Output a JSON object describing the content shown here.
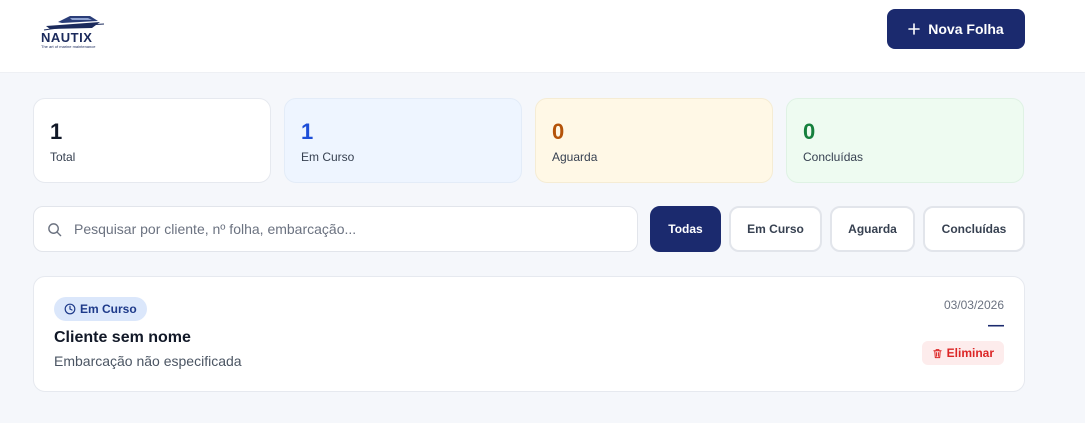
{
  "header": {
    "logo_text": "NAUTIX",
    "logo_tagline": "The art of marine maintenance",
    "new_button_label": "Nova Folha"
  },
  "stats": [
    {
      "value": "1",
      "label": "Total"
    },
    {
      "value": "1",
      "label": "Em Curso"
    },
    {
      "value": "0",
      "label": "Aguarda"
    },
    {
      "value": "0",
      "label": "Concluídas"
    }
  ],
  "search": {
    "placeholder": "Pesquisar por cliente, nº folha, embarcação...",
    "value": ""
  },
  "filters": [
    {
      "label": "Todas",
      "active": true
    },
    {
      "label": "Em Curso",
      "active": false
    },
    {
      "label": "Aguarda",
      "active": false
    },
    {
      "label": "Concluídas",
      "active": false
    }
  ],
  "sheets": [
    {
      "status": "Em Curso",
      "client": "Cliente sem nome",
      "vessel": "Embarcação não especificada",
      "date": "03/03/2026",
      "number": "—",
      "delete_label": "Eliminar"
    }
  ],
  "colors": {
    "brand": "#1b2a6e",
    "in_progress": "#1d4ed8",
    "waiting": "#b45309",
    "done": "#15803d",
    "danger": "#dc2626"
  },
  "icons": [
    "plus-icon",
    "search-icon",
    "clock-icon",
    "trash-icon"
  ]
}
